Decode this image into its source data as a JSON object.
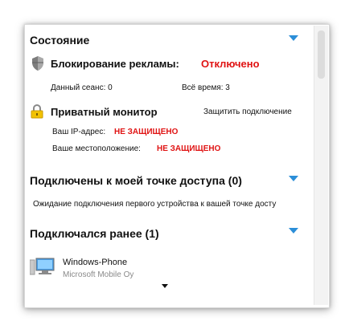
{
  "status": {
    "header": "Состояние",
    "adblock": {
      "label": "Блокирование рекламы:",
      "value": "Отключено",
      "session": "Данный сеанс: 0",
      "alltime": "Всё время: 3"
    },
    "monitor": {
      "label": "Приватный монитор",
      "protect_link": "Защитить подключение",
      "ip_label": "Ваш IP-адрес:",
      "ip_value": "НЕ ЗАЩИЩЕНО",
      "location_label": "Ваше местоположение:",
      "location_value": "НЕ ЗАЩИЩЕНО"
    }
  },
  "hotspot": {
    "header": "Подключены к моей точке доступа (0)",
    "waiting": "Ожидание подключения первого устройства к вашей точке досту"
  },
  "previous": {
    "header": "Подключался ранее (1)",
    "devices": [
      {
        "name": "Windows-Phone",
        "vendor": "Microsoft Mobile Oy",
        "icon": "computer-icon"
      }
    ]
  },
  "colors": {
    "accent": "#2b8ed8",
    "danger": "#e01313"
  }
}
